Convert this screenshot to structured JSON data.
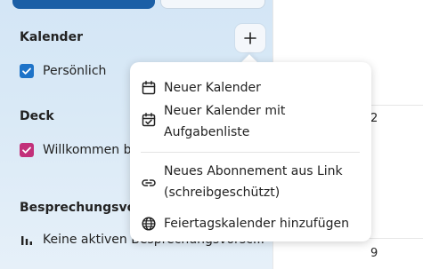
{
  "sidebar": {
    "calendar_section_title": "Kalender",
    "calendars": [
      {
        "label": "Persönlich",
        "color": "#1e73c8",
        "checked": true
      }
    ],
    "deck_section_title": "Deck",
    "deck_boards": [
      {
        "label": "Willkommen be",
        "color": "#c2307a",
        "checked": true
      }
    ],
    "meetings_section_title": "Besprechungsvors",
    "meetings_empty_text": "Keine aktiven Besprechungsvorsc..."
  },
  "calendar_grid": {
    "day_numbers": [
      "2",
      "9"
    ]
  },
  "create_menu": {
    "items": [
      {
        "icon": "calendar-icon",
        "label_line1": "Neuer Kalender",
        "label_line2": ""
      },
      {
        "icon": "calendar-check-icon",
        "label_line1": "Neuer Kalender mit",
        "label_line2": "Aufgabenliste"
      },
      {
        "icon": "link-icon",
        "label_line1": "Neues Abonnement aus Link",
        "label_line2": "(schreibgeschützt)"
      },
      {
        "icon": "globe-icon",
        "label_line1": "Feiertagskalender hinzufügen",
        "label_line2": ""
      }
    ]
  },
  "colors": {
    "primary": "#1b5fa6",
    "sidebar_bg": "#d6e7f6"
  }
}
